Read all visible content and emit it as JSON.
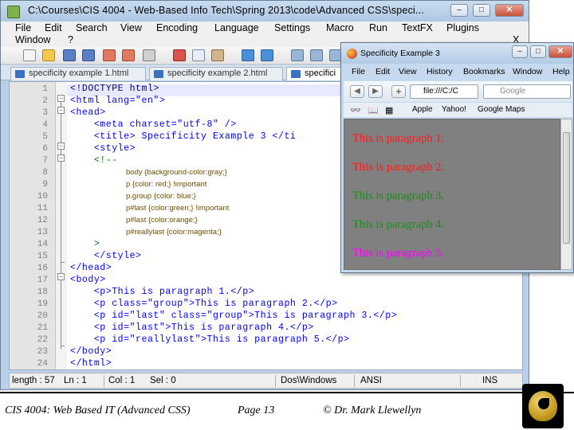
{
  "npp": {
    "title": "C:\\Courses\\CIS 4004 - Web-Based Info Tech\\Spring 2013\\code\\Advanced CSS\\speci...",
    "menu_row1": [
      "File",
      "Edit",
      "Search",
      "View",
      "Encoding",
      "Language",
      "Settings",
      "Macro",
      "Run",
      "TextFX",
      "Plugins"
    ],
    "menu_row2": [
      "Window",
      "?"
    ],
    "close_x": "X",
    "tabs": [
      "specificity example 1.html",
      "specificity example 2.html",
      "specifici"
    ],
    "line_numbers": [
      "1",
      "2",
      "3",
      "4",
      "5",
      "6",
      "7",
      "8",
      "9",
      "10",
      "11",
      "12",
      "13",
      "14",
      "15",
      "16",
      "17",
      "18",
      "19",
      "20",
      "21",
      "22",
      "23",
      "24"
    ],
    "code": [
      "<!DOCTYPE html>",
      "<html lang=\"en\">",
      "<head>",
      "    <meta charset=\"utf-8\" />",
      "    <title> Specificity Example 3 </ti",
      "    <style>",
      "    <!--",
      "body {background-color:gray;}",
      "p {color: red;} !important",
      "p.group {color: blue;}",
      "p#last {color:green;} !important",
      "p#last {color:orange;}",
      "p#reallylast {color:magenta;}",
      "    >",
      "    </style>",
      "</head>",
      "<body>",
      "    <p>This is paragraph 1.</p>",
      "    <p class=\"group\">This is paragraph 2.</p>",
      "    <p id=\"last\" class=\"group\">This is paragraph 3.</p>",
      "    <p id=\"last\">This is paragraph 4.</p>",
      "    <p id=\"reallylast\">This is paragraph 5.</p>",
      "</body>",
      "</html>"
    ],
    "status": {
      "length": "length : 57",
      "ln": "Ln : 1",
      "col": "Col : 1",
      "sel": "Sel : 0",
      "eol": "Dos\\Windows",
      "encoding": "ANSI",
      "mode": "INS"
    }
  },
  "ff": {
    "title": "Specificity Example 3",
    "menu": [
      "File",
      "Edit",
      "View",
      "History",
      "Bookmarks",
      "Window",
      "Help"
    ],
    "back": "◀",
    "forward": "▶",
    "plus": "+",
    "url": "file:///C:/C",
    "search_placeholder": "Google",
    "bookmarks": [
      "Apple",
      "Yahoo!",
      "Google Maps"
    ],
    "paragraphs": [
      {
        "text": "This is paragraph 1.",
        "color": "#ff1a1a"
      },
      {
        "text": "This is paragraph 2.",
        "color": "#ff1a1a"
      },
      {
        "text": "This is paragraph 3.",
        "color": "#1f8a1f"
      },
      {
        "text": "This is paragraph 4.",
        "color": "#1f8a1f"
      },
      {
        "text": "This is paragraph 5.",
        "color": "#ff00ff"
      }
    ],
    "content_bg": "#808080"
  },
  "footer": {
    "course": "CIS 4004: Web Based IT (Advanced CSS)",
    "page": "Page 13",
    "author": "© Dr. Mark Llewellyn"
  }
}
